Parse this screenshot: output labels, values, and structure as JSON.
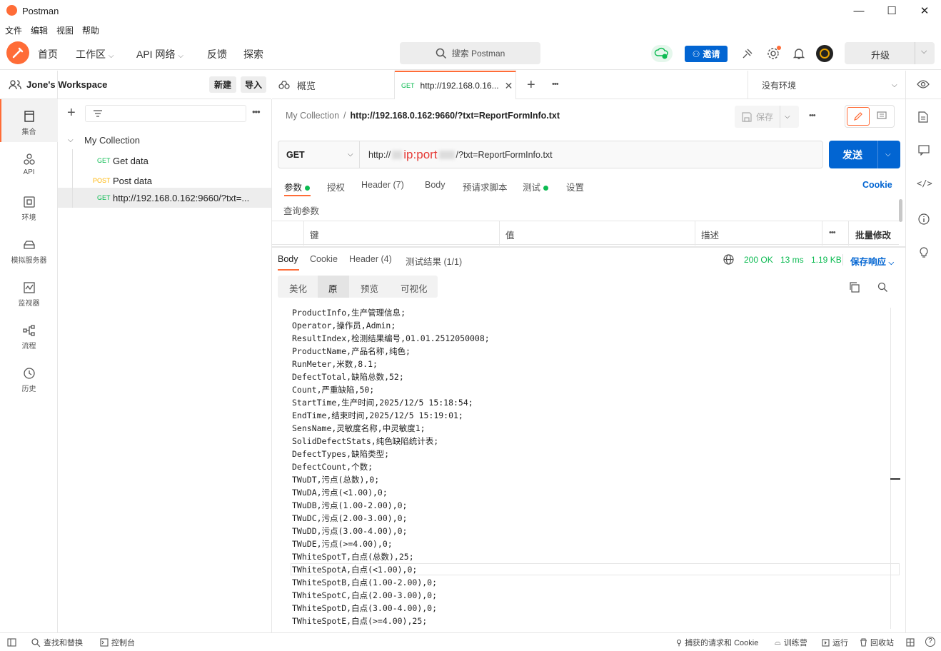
{
  "window": {
    "title": "Postman",
    "minimize": "—",
    "maximize": "☐",
    "close": "✕"
  },
  "menu": [
    "文件",
    "编辑",
    "视图",
    "帮助"
  ],
  "nav": {
    "home": "首页",
    "workspaces": "工作区",
    "api_network": "API 网络",
    "feedback": "反馈",
    "explore": "探索",
    "search_placeholder": "搜索 Postman",
    "invite": "邀请",
    "upgrade": "升级"
  },
  "workspace": {
    "name": "Jone's Workspace",
    "new_btn": "新建",
    "import_btn": "导入"
  },
  "rail": [
    "集合",
    "API",
    "环境",
    "模拟服务器",
    "监视器",
    "流程",
    "历史"
  ],
  "collection": {
    "name": "My Collection",
    "items": [
      {
        "method": "GET",
        "name": "Get data"
      },
      {
        "method": "POST",
        "name": "Post data"
      },
      {
        "method": "GET",
        "name": "http://192.168.0.162:9660/?txt=..."
      }
    ]
  },
  "tabs": {
    "overview": "概览",
    "active_method": "GET",
    "active_label": "http://192.168.0.16...",
    "env": "没有环境"
  },
  "request": {
    "breadcrumb_collection": "My Collection",
    "breadcrumb_sep": "/",
    "breadcrumb_url": "http://192.168.0.162:9660/?txt=ReportFormInfo.txt",
    "save": "保存",
    "method": "GET",
    "url_prefix": "http://",
    "url_overlay": "ip:port",
    "url_suffix": "/?txt=ReportFormInfo.txt",
    "send": "发送",
    "tabs": [
      "参数",
      "授权",
      "Header (7)",
      "Body",
      "预请求脚本",
      "测试",
      "设置"
    ],
    "cookie": "Cookie",
    "query_title": "查询参数",
    "cols": [
      "键",
      "值",
      "描述",
      "批量修改"
    ]
  },
  "response": {
    "tabs": [
      "Body",
      "Cookie",
      "Header (4)",
      "测试结果 (1/1)"
    ],
    "status": "200 OK",
    "time": "13 ms",
    "size": "1.19 KB",
    "save": "保存响应",
    "views": [
      "美化",
      "原",
      "预览",
      "可视化"
    ],
    "lines": [
      "ProductInfo,生产管理信息;",
      "Operator,操作员,Admin;",
      "ResultIndex,检测结果编号,01.01.2512050008;",
      "ProductName,产品名称,纯色;",
      "RunMeter,米数,8.1;",
      "DefectTotal,缺陷总数,52;",
      "Count,严重缺陷,50;",
      "StartTime,生产时间,2025/12/5 15:18:54;",
      "EndTime,结束时间,2025/12/5 15:19:01;",
      "SensName,灵敏度名称,中灵敏度1;",
      "SolidDefectStats,纯色缺陷统计表;",
      "DefectTypes,缺陷类型;",
      "DefectCount,个数;",
      "TWuDT,污点(总数),0;",
      "TWuDA,污点(<1.00),0;",
      "TWuDB,污点(1.00-2.00),0;",
      "TWuDC,污点(2.00-3.00),0;",
      "TWuDD,污点(3.00-4.00),0;",
      "TWuDE,污点(>=4.00),0;",
      "TWhiteSpotT,白点(总数),25;",
      "TWhiteSpotA,白点(<1.00),0;",
      "TWhiteSpotB,白点(1.00-2.00),0;",
      "TWhiteSpotC,白点(2.00-3.00),0;",
      "TWhiteSpotD,白点(3.00-4.00),0;",
      "TWhiteSpotE,白点(>=4.00),25;"
    ]
  },
  "statusbar": {
    "find": "查找和替换",
    "console": "控制台",
    "capture": "捕获的请求和 Cookie",
    "bootcamp": "训练营",
    "runner": "运行",
    "trash": "回收站",
    "help": "?"
  },
  "colors": {
    "accent": "#ff6c37",
    "blue": "#0265d2",
    "green": "#0cbb52",
    "post": "#ffb400"
  }
}
